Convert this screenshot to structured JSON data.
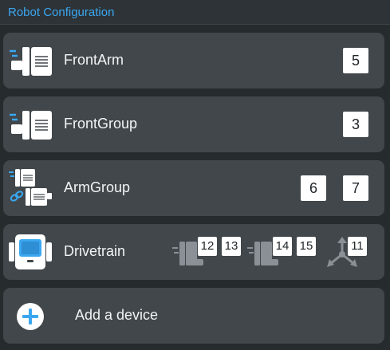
{
  "header": {
    "title": "Robot Configuration"
  },
  "devices": [
    {
      "name": "FrontArm",
      "icon": "motor-icon",
      "ports": [
        "5"
      ]
    },
    {
      "name": "FrontGroup",
      "icon": "motor-icon",
      "ports": [
        "3"
      ]
    },
    {
      "name": "ArmGroup",
      "icon": "motor-group-icon",
      "ports": [
        "6",
        "7"
      ]
    },
    {
      "name": "Drivetrain",
      "icon": "brain-icon",
      "ports": {
        "left_motors": [
          "12",
          "13"
        ],
        "right_motors": [
          "14",
          "15"
        ],
        "gyro": [
          "11"
        ]
      }
    }
  ],
  "add_device": {
    "label": "Add a device",
    "icon": "plus-icon"
  },
  "colors": {
    "accent": "#3ba7f0",
    "card_bg": "#41474b",
    "page_bg": "#262b2e",
    "text": "#f2f4f5"
  }
}
